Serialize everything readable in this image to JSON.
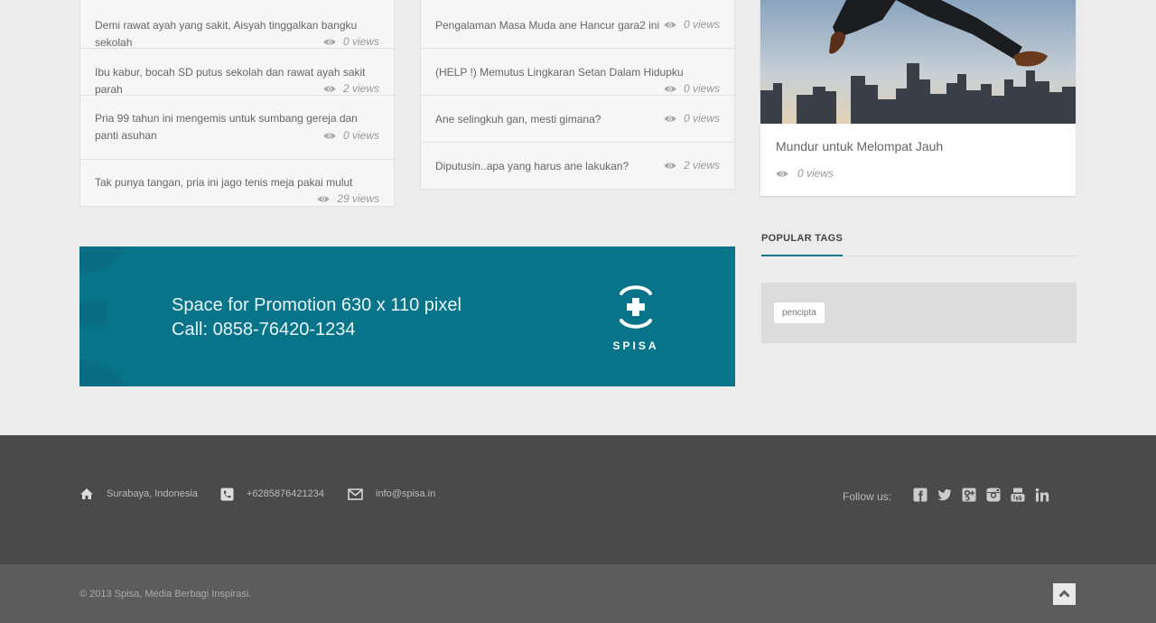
{
  "left_list": [
    {
      "title": "Demi rawat ayah yang sakit, Aisyah tinggalkan bangku sekolah",
      "views": "0 views"
    },
    {
      "title": "Ibu kabur, bocah SD putus sekolah dan rawat ayah sakit parah",
      "views": "2 views"
    },
    {
      "title": "Pria 99 tahun ini mengemis untuk sumbang gereja dan panti asuhan",
      "views": "0 views"
    },
    {
      "title": "Tak punya tangan, pria ini jago tenis meja pakai mulut",
      "views": "29 views"
    }
  ],
  "right_list": [
    {
      "title": "Pengalaman Masa Muda ane Hancur gara2 ini",
      "views": "0 views"
    },
    {
      "title": "(HELP !) Memutus Lingkaran Setan Dalam Hidupku",
      "views": "0 views"
    },
    {
      "title": "Ane selingkuh gan, mesti gimana?",
      "views": "0 views"
    },
    {
      "title": "Diputusin..apa yang harus ane lakukan?",
      "views": "2 views"
    }
  ],
  "featured": {
    "title": "Mundur untuk Melompat Jauh",
    "views": "0 views"
  },
  "popular_tags": {
    "title": "POPULAR TAGS",
    "tags": [
      "pencipta"
    ]
  },
  "promo": {
    "line1": "Space for Promotion 630 x 110 pixel",
    "line2": "Call: 0858-76420-1234",
    "logo_text": "SPISA"
  },
  "footer": {
    "address": "Surabaya, Indonesia",
    "phone": "+6285876421234",
    "email": "info@spisa.in",
    "follow_label": "Follow us:",
    "social_icons": [
      "facebook-icon",
      "twitter-icon",
      "google-plus-icon",
      "instagram-icon",
      "youtube-icon",
      "linkedin-icon"
    ]
  },
  "copyright": "© 2013 Spisa, Media Berbagi Inspirasi.",
  "colors": {
    "accent": "#08748a",
    "footer": "#4a4a4a",
    "bottom_bar": "#5c5c5c"
  }
}
